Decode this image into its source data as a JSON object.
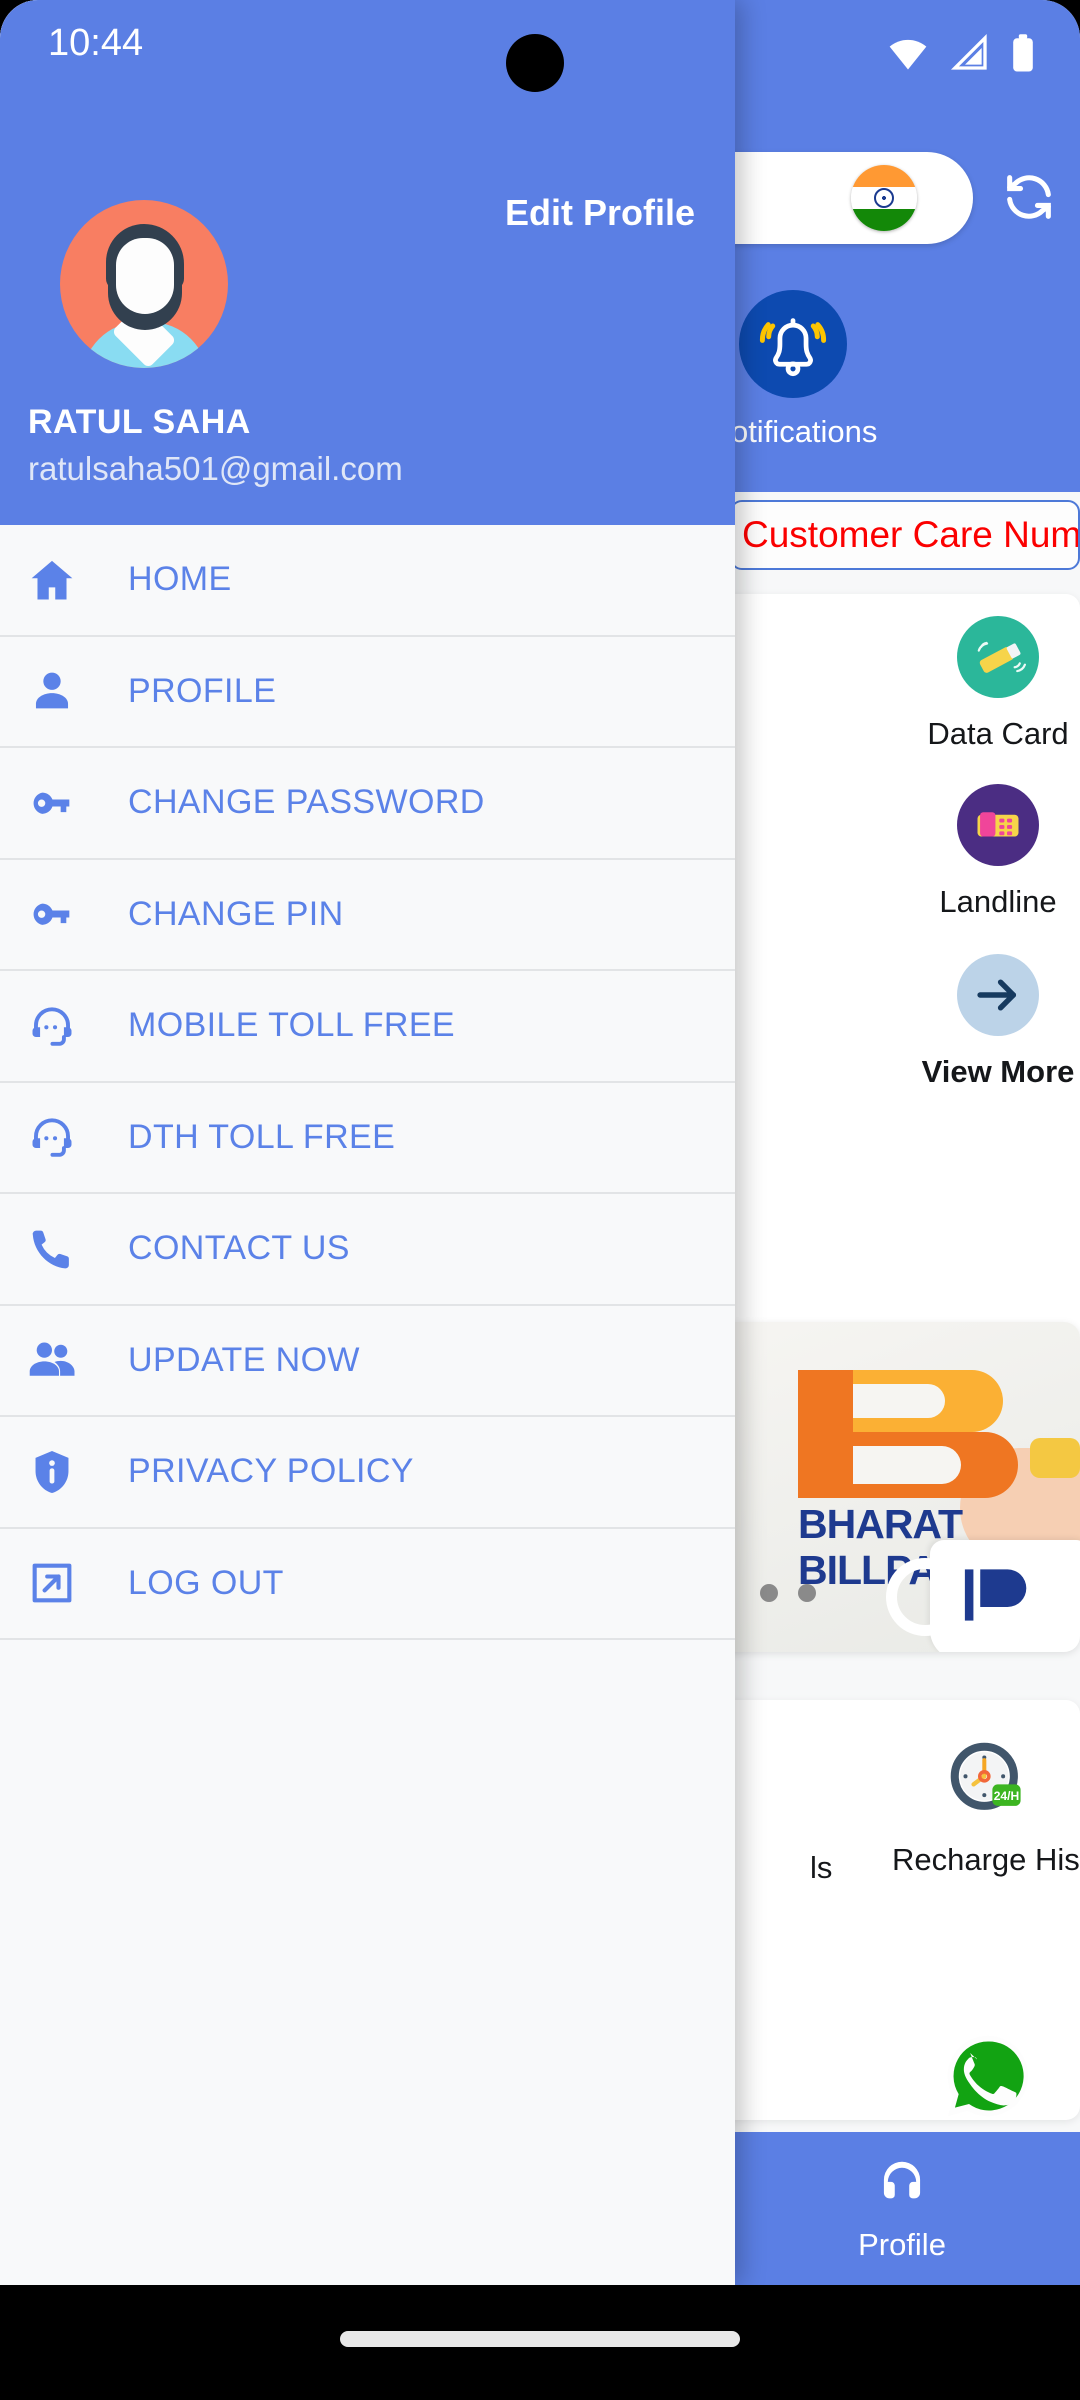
{
  "status_bar": {
    "time": "10:44",
    "icons": [
      "wifi-icon",
      "cellular-signal-icon",
      "battery-icon"
    ]
  },
  "drawer": {
    "edit_profile_label": "Edit Profile",
    "user_name": "RATUL SAHA",
    "user_email": "ratulsaha501@gmail.com",
    "avatar_icon": "user-avatar-illustration",
    "menu": [
      {
        "label": "HOME",
        "icon": "home-icon"
      },
      {
        "label": "PROFILE",
        "icon": "person-icon"
      },
      {
        "label": "CHANGE PASSWORD",
        "icon": "key-icon"
      },
      {
        "label": "CHANGE PIN",
        "icon": "key-icon"
      },
      {
        "label": "MOBILE TOLL FREE",
        "icon": "headset-support-icon"
      },
      {
        "label": "DTH TOLL FREE",
        "icon": "headset-support-icon"
      },
      {
        "label": "CONTACT US",
        "icon": "phone-icon"
      },
      {
        "label": "UPDATE NOW",
        "icon": "people-icon"
      },
      {
        "label": "PRIVACY POLICY",
        "icon": "shield-info-icon"
      },
      {
        "label": "LOG OUT",
        "icon": "logout-icon"
      }
    ]
  },
  "home": {
    "balance_chip": {
      "flag_icon": "india-flag-icon"
    },
    "refresh_icon": "refresh-icon",
    "notifications": {
      "label": "Notifications",
      "icon": "bell-ring-icon"
    },
    "customer_care": {
      "text": "Customer Care Numb"
    },
    "services": [
      {
        "label": "Data Card",
        "icon": "data-card-icon"
      },
      {
        "label": "Landline",
        "icon": "landline-phone-icon"
      },
      {
        "label": "View More",
        "icon": "arrow-right-icon"
      }
    ],
    "banner": {
      "logo_text_line1": "BHARAT",
      "logo_text_line2": "BILLPAY",
      "carousel_dots": 2
    },
    "history": {
      "label": "Recharge History",
      "icon": "clock-24h-icon",
      "badge": "24/H",
      "partial_label": "ls"
    },
    "whatsapp_fab": {
      "icon": "whatsapp-icon"
    },
    "bottom_nav": [
      {
        "label": "Profile",
        "icon": "profile-icon"
      }
    ]
  },
  "colors": {
    "brand_blue": "#5b7fe4",
    "menu_text_blue": "#5b82e8",
    "drawer_bg": "#f8f9fa",
    "alert_red": "#fb0000",
    "notif_circle": "#0d4ab0",
    "whatsapp_green": "#1fa855"
  }
}
